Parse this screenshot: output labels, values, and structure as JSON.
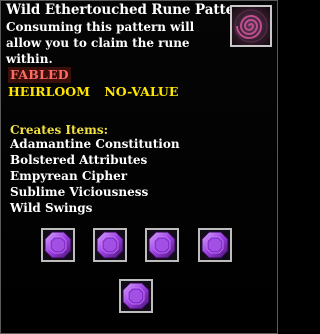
{
  "item": {
    "title": "Wild Ethertouched Rune Pattern",
    "description": "Consuming this pattern will allow you to claim the rune within.",
    "icon": "swirl-rune-icon",
    "tier": "FABLED",
    "flags": [
      "HEIRLOOM",
      "NO-VALUE"
    ]
  },
  "creates": {
    "label": "Creates Items:",
    "items": [
      "Adamantine Constitution",
      "Bolstered Attributes",
      "Empyrean Cipher",
      "Sublime Viciousness",
      "Wild Swings"
    ]
  },
  "reward_slots": [
    "purple-gem-icon",
    "purple-gem-icon",
    "purple-gem-icon",
    "purple-gem-icon",
    "purple-gem-icon"
  ],
  "colors": {
    "tier_text": "#ff6a62",
    "flags_text": "#ffe600",
    "gem": "#9b3ee0"
  }
}
